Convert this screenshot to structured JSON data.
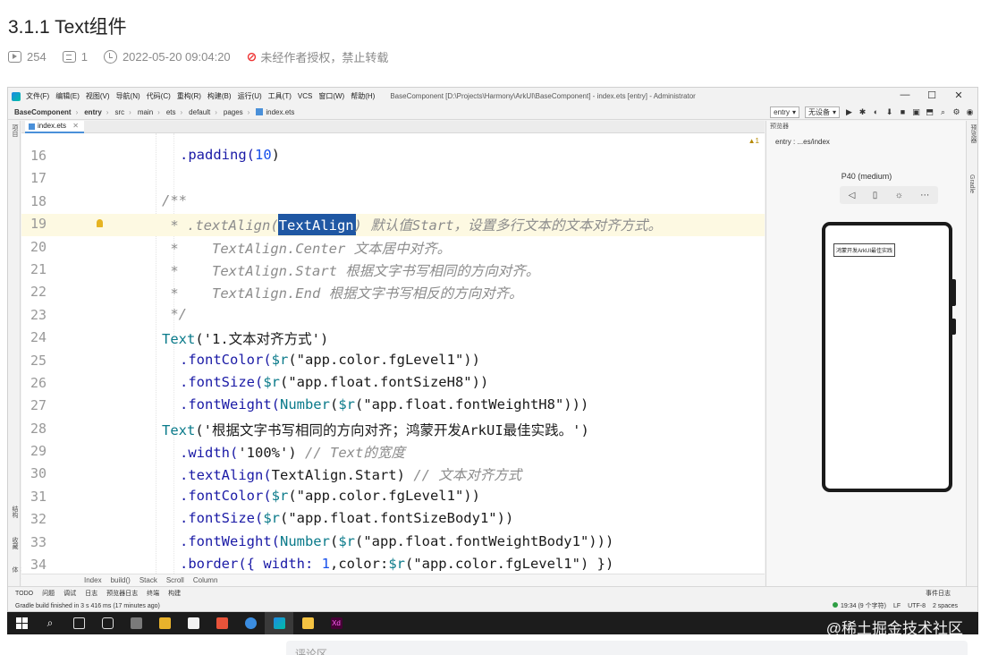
{
  "article": {
    "title": "3.1.1 Text组件",
    "views": "254",
    "comments": "1",
    "datetime": "2022-05-20 09:04:20",
    "copyright": "未经作者授权，禁止转载"
  },
  "ide": {
    "menus": [
      "文件(F)",
      "编辑(E)",
      "视图(V)",
      "导航(N)",
      "代码(C)",
      "重构(R)",
      "构建(B)",
      "运行(U)",
      "工具(T)",
      "VCS",
      "窗口(W)",
      "帮助(H)"
    ],
    "window_title": "BaseComponent [D:\\Projects\\Harmony\\ArkUI\\BaseComponent] - index.ets [entry] - Administrator",
    "window_controls": [
      "—",
      "☐",
      "✕"
    ],
    "breadcrumbs": [
      "BaseComponent",
      "entry",
      "src",
      "main",
      "ets",
      "default",
      "pages",
      "index.ets"
    ],
    "run_config": "entry",
    "device_select": "无设备",
    "file_tab": "index.ets",
    "warning_indicator": "▲1",
    "code_lines": [
      {
        "n": "16",
        "indent": 1,
        "parts": [
          {
            "t": ".padding(",
            "c": "fn"
          },
          {
            "t": "10",
            "c": "num"
          },
          {
            "t": ")",
            "c": "str"
          }
        ]
      },
      {
        "n": "17",
        "indent": 0,
        "parts": []
      },
      {
        "n": "18",
        "indent": 0,
        "parts": [
          {
            "t": "/**",
            "c": "cm"
          }
        ]
      },
      {
        "n": "19",
        "indent": 0,
        "parts": [
          {
            "t": " * .textAlign(",
            "c": "cm"
          },
          {
            "t": "TextAlign",
            "c": "sel"
          },
          {
            "t": ") 默认值Start，设置多行文本的文本对齐方式。",
            "c": "cm"
          }
        ]
      },
      {
        "n": "20",
        "indent": 0,
        "parts": [
          {
            "t": " *    TextAlign.Center 文本居中对齐。",
            "c": "cm"
          }
        ]
      },
      {
        "n": "21",
        "indent": 0,
        "parts": [
          {
            "t": " *    TextAlign.Start 根据文字书写相同的方向对齐。",
            "c": "cm"
          }
        ]
      },
      {
        "n": "22",
        "indent": 0,
        "parts": [
          {
            "t": " *    TextAlign.End 根据文字书写相反的方向对齐。",
            "c": "cm"
          }
        ]
      },
      {
        "n": "23",
        "indent": 0,
        "parts": [
          {
            "t": " */",
            "c": "cm"
          }
        ]
      },
      {
        "n": "24",
        "indent": 0,
        "parts": [
          {
            "t": "Text",
            "c": "kw"
          },
          {
            "t": "('1.文本对齐方式')",
            "c": "str"
          }
        ]
      },
      {
        "n": "25",
        "indent": 1,
        "parts": [
          {
            "t": ".fontColor(",
            "c": "fn"
          },
          {
            "t": "$r",
            "c": "kw"
          },
          {
            "t": "(\"app.color.fgLevel1\"))",
            "c": "str"
          }
        ]
      },
      {
        "n": "26",
        "indent": 1,
        "parts": [
          {
            "t": ".fontSize(",
            "c": "fn"
          },
          {
            "t": "$r",
            "c": "kw"
          },
          {
            "t": "(\"app.float.fontSizeH8\"))",
            "c": "str"
          }
        ]
      },
      {
        "n": "27",
        "indent": 1,
        "parts": [
          {
            "t": ".fontWeight(",
            "c": "fn"
          },
          {
            "t": "Number",
            "c": "kw"
          },
          {
            "t": "(",
            "c": "str"
          },
          {
            "t": "$r",
            "c": "kw"
          },
          {
            "t": "(\"app.float.fontWeightH8\")))",
            "c": "str"
          }
        ]
      },
      {
        "n": "28",
        "indent": 0,
        "parts": [
          {
            "t": "Text",
            "c": "kw"
          },
          {
            "t": "('根据文字书写相同的方向对齐；鸿蒙开发ArkUI最佳实践。')",
            "c": "str"
          }
        ]
      },
      {
        "n": "29",
        "indent": 1,
        "parts": [
          {
            "t": ".width(",
            "c": "fn"
          },
          {
            "t": "'100%'",
            "c": "str"
          },
          {
            "t": ") ",
            "c": "str"
          },
          {
            "t": "// Text的宽度",
            "c": "cm"
          }
        ]
      },
      {
        "n": "30",
        "indent": 1,
        "parts": [
          {
            "t": ".textAlign(",
            "c": "fn"
          },
          {
            "t": "TextAlign.Start",
            "c": "str"
          },
          {
            "t": ") ",
            "c": "str"
          },
          {
            "t": "// 文本对齐方式",
            "c": "cm"
          }
        ]
      },
      {
        "n": "31",
        "indent": 1,
        "parts": [
          {
            "t": ".fontColor(",
            "c": "fn"
          },
          {
            "t": "$r",
            "c": "kw"
          },
          {
            "t": "(\"app.color.fgLevel1\"))",
            "c": "str"
          }
        ]
      },
      {
        "n": "32",
        "indent": 1,
        "parts": [
          {
            "t": ".fontSize(",
            "c": "fn"
          },
          {
            "t": "$r",
            "c": "kw"
          },
          {
            "t": "(\"app.float.fontSizeBody1\"))",
            "c": "str"
          }
        ]
      },
      {
        "n": "33",
        "indent": 1,
        "parts": [
          {
            "t": ".fontWeight(",
            "c": "fn"
          },
          {
            "t": "Number",
            "c": "kw"
          },
          {
            "t": "(",
            "c": "str"
          },
          {
            "t": "$r",
            "c": "kw"
          },
          {
            "t": "(\"app.float.fontWeightBody1\")))",
            "c": "str"
          }
        ]
      },
      {
        "n": "34",
        "indent": 1,
        "parts": [
          {
            "t": ".border({ width: ",
            "c": "fn"
          },
          {
            "t": "1",
            "c": "num"
          },
          {
            "t": ",color:",
            "c": "str"
          },
          {
            "t": "$r",
            "c": "kw"
          },
          {
            "t": "(\"app.color.fgLevel1\") })",
            "c": "str"
          }
        ]
      }
    ],
    "code_breadcrumb": [
      "Index",
      "build()",
      "Stack",
      "Scroll",
      "Column"
    ],
    "previewer": {
      "header": "预览器",
      "entry_path": "entry : ...es/index",
      "device_name": "P40 (medium)",
      "tools": [
        "◁",
        "▯",
        "☼",
        "⋯"
      ],
      "phone_text": "鸿蒙开发ArkUI最佳实践"
    },
    "left_strip_labels": [
      "项目",
      "结构",
      "收藏",
      "构建变体"
    ],
    "right_strip_labels": [
      "预览器",
      "Gradle"
    ],
    "bottom_tools": [
      "TODO",
      "问题",
      "调试",
      "日志",
      "预览器日志",
      "终端",
      "构建"
    ],
    "bottom_tools_right": "事件日志",
    "status_message": "Gradle build finished in 3 s 416 ms (17 minutes ago)",
    "status_right": [
      "19:34 (9 个字符)",
      "LF",
      "UTF-8",
      "2 spaces"
    ]
  },
  "taskbar": {
    "watermark": "@稀土掘金技术社区"
  },
  "footer": {
    "comment_placeholder": "评论区"
  },
  "colors": {
    "selection": "#1f57a3",
    "current_line": "#fdf9e2",
    "keyword": "#0a7a8a",
    "number": "#1750eb",
    "comment": "#8c8c8c"
  }
}
